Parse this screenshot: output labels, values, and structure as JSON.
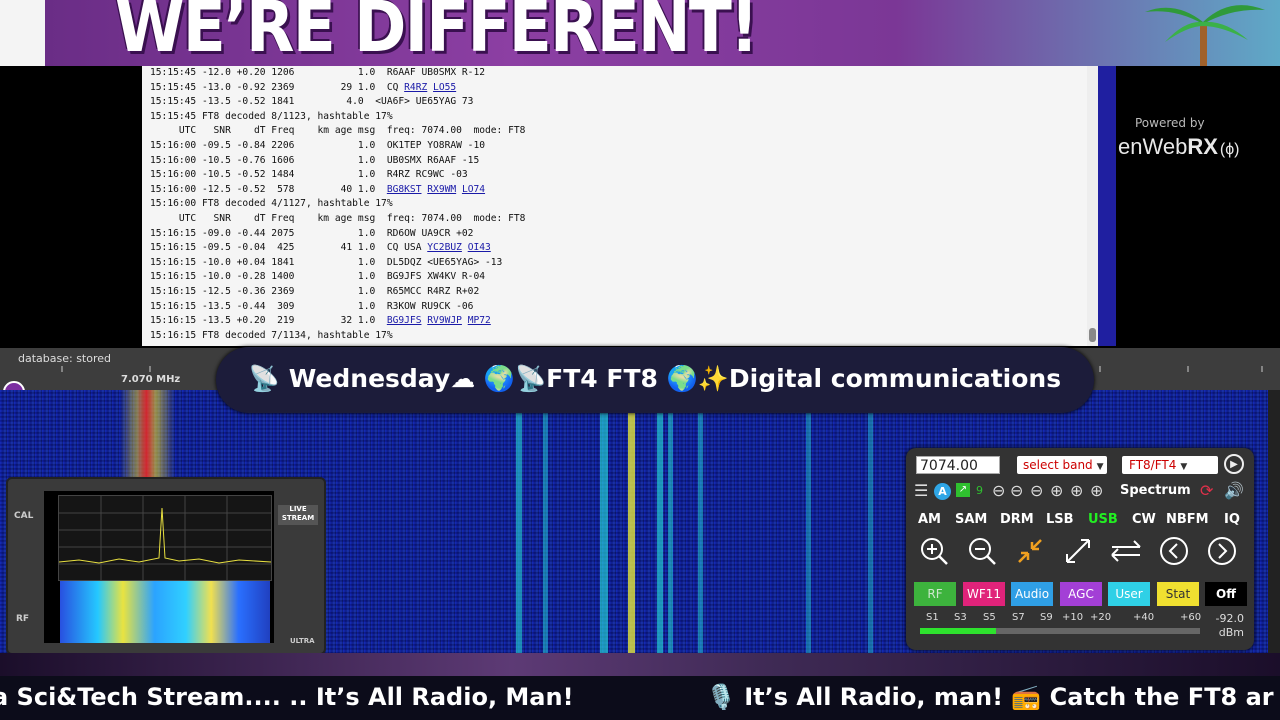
{
  "banner": {
    "title": "WE’RE DIFFERENT!"
  },
  "decoder_log": {
    "lines": [
      [
        {
          "t": "15:15:45 -12.0 +0.20 1206           1.0  R6AAF UB0SMX R-12"
        }
      ],
      [
        {
          "t": "15:15:45 -13.0 -0.92 2369        29 1.0  CQ "
        },
        {
          "t": "R4RZ",
          "link": true
        },
        {
          "t": " "
        },
        {
          "t": "LO55",
          "link": true
        }
      ],
      [
        {
          "t": "15:15:45 -13.5 -0.52 1841         4.0  <UA6F> UE65YAG 73"
        }
      ],
      [
        {
          "t": "15:15:45 FT8 decoded 8/1123, hashtable 17%"
        }
      ],
      [
        {
          "t": "     UTC   SNR    dT Freq    km age msg  freq: 7074.00  mode: FT8"
        }
      ],
      [
        {
          "t": "15:16:00 -09.5 -0.84 2206           1.0  OK1TEP YO8RAW -10"
        }
      ],
      [
        {
          "t": "15:16:00 -10.5 -0.76 1606           1.0  UB0SMX R6AAF -15"
        }
      ],
      [
        {
          "t": "15:16:00 -10.5 -0.52 1484           1.0  R4RZ RC9WC -03"
        }
      ],
      [
        {
          "t": "15:16:00 -12.5 -0.52  578        40 1.0  "
        },
        {
          "t": "BG8KST",
          "link": true
        },
        {
          "t": " "
        },
        {
          "t": "RX9WM",
          "link": true
        },
        {
          "t": " "
        },
        {
          "t": "LO74",
          "link": true
        }
      ],
      [
        {
          "t": "15:16:00 FT8 decoded 4/1127, hashtable 17%"
        }
      ],
      [
        {
          "t": "     UTC   SNR    dT Freq    km age msg  freq: 7074.00  mode: FT8"
        }
      ],
      [
        {
          "t": "15:16:15 -09.0 -0.44 2075           1.0  RD6OW UA9CR +02"
        }
      ],
      [
        {
          "t": "15:16:15 -09.5 -0.04  425        41 1.0  CQ USA "
        },
        {
          "t": "YC2BUZ",
          "link": true
        },
        {
          "t": " "
        },
        {
          "t": "OI43",
          "link": true
        }
      ],
      [
        {
          "t": "15:16:15 -10.0 +0.04 1841           1.0  DL5DQZ <UE65YAG> -13"
        }
      ],
      [
        {
          "t": "15:16:15 -10.0 -0.28 1400           1.0  BG9JFS XW4KV R-04"
        }
      ],
      [
        {
          "t": "15:16:15 -12.5 -0.36 2369           1.0  R65MCC R4RZ R+02"
        }
      ],
      [
        {
          "t": "15:16:15 -13.5 -0.44  309           1.0  R3KOW RU9CK -06"
        }
      ],
      [
        {
          "t": "15:16:15 -13.5 +0.20  219        32 1.0  "
        },
        {
          "t": "BG9JFS",
          "link": true
        },
        {
          "t": " "
        },
        {
          "t": "RV9WJP",
          "link": true
        },
        {
          "t": " "
        },
        {
          "t": "MP72",
          "link": true
        }
      ],
      [
        {
          "t": "15:16:15 FT8 decoded 7/1134, hashtable 17%"
        }
      ]
    ]
  },
  "branding": {
    "powered_by": "Powered by",
    "logo_prefix": "enWeb",
    "logo_bold": "RX",
    "logo_icon": "(ϕ)"
  },
  "scale": {
    "db_status": "database: stored",
    "freq_label": "7.070 MHz"
  },
  "overlay_title": "📡 Wednesday☁ 🌍📡FT4 FT8 🌍✨Digital communications",
  "device": {
    "live_badge": "LIVE STREAM",
    "side_top": "CAL",
    "side_bottom": "RF",
    "ultra": "ULTRA"
  },
  "receiver": {
    "frequency": "7074.00",
    "band_select": "select band",
    "mode_select": "FT8/FT4",
    "spectrum": "Spectrum",
    "modes": [
      "AM",
      "SAM",
      "DRM",
      "LSB",
      "USB",
      "CW",
      "NBFM",
      "IQ"
    ],
    "active_mode": "USB",
    "buttons": [
      {
        "label": "RF",
        "bg": "#3db33d",
        "fg": "#cde8cd"
      },
      {
        "label": "WF11",
        "bg": "#e0237a",
        "fg": "#ffffff"
      },
      {
        "label": "Audio",
        "bg": "#2f9fe6",
        "fg": "#ffffff"
      },
      {
        "label": "AGC",
        "bg": "#a33fd6",
        "fg": "#ffffff"
      },
      {
        "label": "User",
        "bg": "#2fd0e6",
        "fg": "#ffffff"
      },
      {
        "label": "Stat",
        "bg": "#f0e030",
        "fg": "#333333"
      },
      {
        "label": "Off",
        "bg": "#000000",
        "fg": "#ffffff"
      }
    ],
    "smeter_scale": [
      "S1",
      "S3",
      "S5",
      "S7",
      "S9",
      "+10",
      "+20",
      "+40",
      "+60"
    ],
    "smeter_level": 0.27,
    "smeter_value": "-92.0",
    "smeter_unit": "dBm"
  },
  "ticker": {
    "left": "a Sci&Tech Stream.... .. It’s All Radio, Man!",
    "right": "🎙️ It’s All Radio, man! 📻 Catch the FT8 ar"
  }
}
